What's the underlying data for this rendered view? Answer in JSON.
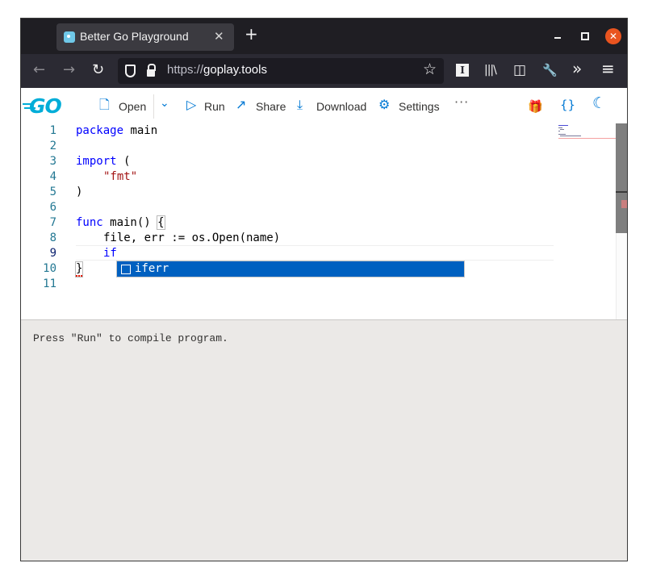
{
  "browser": {
    "tab_title": "Better Go Playground",
    "tab_close": "✕",
    "new_tab": "+",
    "win_close": "✕",
    "url_prefix": "https://",
    "url_host": "goplay.tools",
    "back": "←",
    "forward": "→",
    "reload": "↻",
    "bookmark_star": "☆",
    "reader": "I",
    "library": "|||\\",
    "sidebar": "◫",
    "wrench": "🔧",
    "overflow": "»",
    "menu": "≡"
  },
  "toolbar": {
    "logo": "GO",
    "open_label": "Open",
    "run_label": "Run",
    "share_label": "Share",
    "download_label": "Download",
    "settings_label": "Settings",
    "more": "···",
    "chevron": "⌄",
    "gift": "🎁",
    "format": "{}",
    "theme": "☾",
    "icons": {
      "open": "🗋",
      "run": "▷",
      "share": "↗",
      "download": "⤓",
      "settings": "⚙"
    }
  },
  "editor": {
    "line_numbers": [
      "1",
      "2",
      "3",
      "4",
      "5",
      "6",
      "7",
      "8",
      "9",
      "10",
      "11"
    ],
    "current_line": 9,
    "code": {
      "l1_kw": "package",
      "l1_rest": " main",
      "l3_kw": "import",
      "l3_rest": " (",
      "l4_str": "\"fmt\"",
      "l5": ")",
      "l7_kw": "func",
      "l7_rest": " main() ",
      "l7_brace": "{",
      "l8": "file, err := os.Open(name)",
      "l9_kw": "if",
      "l10": "}"
    },
    "suggestion": {
      "label": "iferr"
    }
  },
  "output": {
    "text": "Press \"Run\" to compile program."
  }
}
